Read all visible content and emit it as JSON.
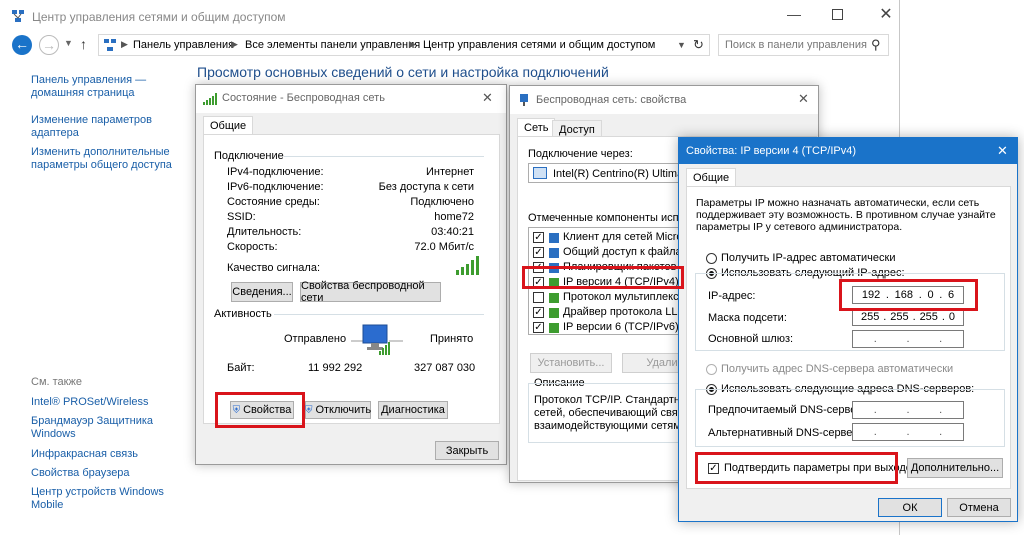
{
  "main_window": {
    "title": "Центр управления сетями и общим доступом",
    "breadcrumb": [
      "Панель управления",
      "Все элементы панели управления",
      "Центр управления сетями и общим доступом"
    ],
    "search_placeholder": "Поиск в панели управления",
    "page_heading": "Просмотр основных сведений о сети и настройка подключений"
  },
  "sidebar": {
    "links": [
      "Панель управления —\nдомашняя страница",
      "Изменение параметров\nадаптера",
      "Изменить дополнительные\nпараметры общего доступа"
    ],
    "see_also_title": "См. также",
    "see_also": [
      "Intel® PROSet/Wireless",
      "Брандмауэр Защитника\nWindows",
      "Инфракрасная связь",
      "Свойства браузера",
      "Центр устройств Windows\nMobile"
    ]
  },
  "status_dialog": {
    "title": "Состояние - Беспроводная сеть",
    "tab": "Общие",
    "connection_group": "Подключение",
    "rows": [
      {
        "label": "IPv4-подключение:",
        "value": "Интернет"
      },
      {
        "label": "IPv6-подключение:",
        "value": "Без доступа к сети"
      },
      {
        "label": "Состояние среды:",
        "value": "Подключено"
      },
      {
        "label": "SSID:",
        "value": "home72"
      },
      {
        "label": "Длительность:",
        "value": "03:40:21"
      },
      {
        "label": "Скорость:",
        "value": "72.0 Мбит/с"
      }
    ],
    "signal_label": "Качество сигнала:",
    "details_button": "Сведения...",
    "wireless_props_button": "Свойства беспроводной сети",
    "activity_group": "Активность",
    "sent_label": "Отправлено",
    "received_label": "Принято",
    "bytes_label": "Байт:",
    "bytes_sent": "11 992 292",
    "bytes_received": "327 087 030",
    "properties_button": "Свойства",
    "disable_button": "Отключить",
    "diagnostics_button": "Диагностика",
    "close_button": "Закрыть"
  },
  "props_dialog": {
    "title": "Беспроводная сеть: свойства",
    "tabs": [
      "Сеть",
      "Доступ"
    ],
    "connect_via_label": "Подключение через:",
    "adapter": "Intel(R) Centrino(R) Ultimate-N",
    "components_label": "Отмеченные компоненты использу",
    "components": [
      {
        "label": "Клиент для сетей Microsoft",
        "checked": true
      },
      {
        "label": "Общий доступ к файлам и",
        "checked": true
      },
      {
        "label": "Планировщик пакетов Qo",
        "checked": true
      },
      {
        "label": "IP версии 4 (TCP/IPv4)",
        "checked": true
      },
      {
        "label": "Протокол мультиплексора",
        "checked": false
      },
      {
        "label": "Драйвер протокола LLDP",
        "checked": true
      },
      {
        "label": "IP версии 6 (TCP/IPv6)",
        "checked": true
      }
    ],
    "install_button": "Установить...",
    "remove_button": "Удали",
    "description_group": "Описание",
    "description": "Протокол TCP/IP. Стандартный\nсетей, обеспечивающий связь м\nвзаимодействующими сетями."
  },
  "ipv4_dialog": {
    "title": "Свойства: IP версии 4 (TCP/IPv4)",
    "tab": "Общие",
    "intro": "Параметры IP можно назначать автоматически, если сеть\nподдерживает эту возможность. В противном случае узнайте\nпараметры IP у сетевого администратора.",
    "auto_ip": "Получить IP-адрес автоматически",
    "manual_ip": "Использовать следующий IP-адрес:",
    "ip_label": "IP-адрес:",
    "ip_octets": [
      "192",
      "168",
      "0",
      "6"
    ],
    "mask_label": "Маска подсети:",
    "mask_octets": [
      "255",
      "255",
      "255",
      "0"
    ],
    "gateway_label": "Основной шлюз:",
    "auto_dns": "Получить адрес DNS-сервера автоматически",
    "manual_dns": "Использовать следующие адреса DNS-серверов:",
    "pref_dns_label": "Предпочитаемый DNS-сервер:",
    "alt_dns_label": "Альтернативный DNS-сервер:",
    "validate_label": "Подтвердить параметры при выходе",
    "advanced_button": "Дополнительно...",
    "ok_button": "ОК",
    "cancel_button": "Отмена"
  },
  "colors": {
    "accent": "#1a73c9",
    "highlight": "#d9141b",
    "link": "#1a5fa8"
  }
}
